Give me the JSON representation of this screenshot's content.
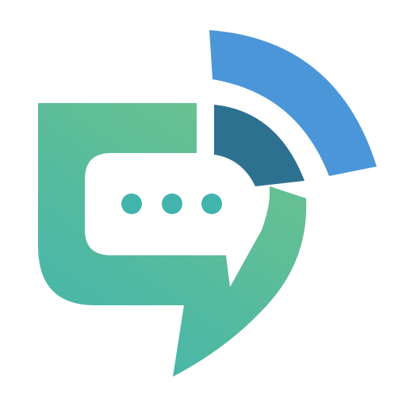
{
  "logo": {
    "icon": "chat-bubble-signal-logo",
    "colors": {
      "background": "#ffffff",
      "bubble_top": "#6cc38c",
      "bubble_bottom": "#43b4ad",
      "signal_inner": "#2d7191",
      "signal_outer": "#4b96d8",
      "dots": "#43b4ad"
    }
  }
}
